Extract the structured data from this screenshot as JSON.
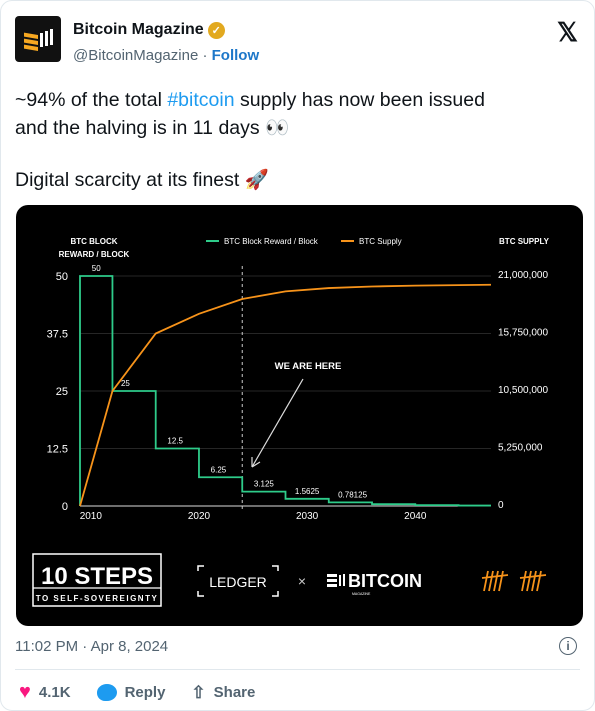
{
  "author": {
    "name": "Bitcoin Magazine",
    "handle": "@BitcoinMagazine",
    "separator": "·",
    "follow_label": "Follow",
    "verified_icon": "verified-badge-gold"
  },
  "platform_icon": "x-logo",
  "tweet": {
    "line1_pre": "~94% of the total ",
    "hashtag": "#bitcoin",
    "line1_post": " supply has now been issued",
    "line2": "and the halving is in 11 days 👀",
    "line3": "Digital scarcity at its finest 🚀"
  },
  "colors": {
    "hashtag": "#1d9bf0",
    "reward_line": "#2ecc8a",
    "supply_line": "#f7931a",
    "like": "#f91880"
  },
  "chart_data": {
    "type": "line",
    "left_axis_title": [
      "BTC BLOCK",
      "REWARD / BLOCK"
    ],
    "right_axis_title": "BTC SUPPLY",
    "legend": [
      "BTC Block Reward / Block",
      "BTC Supply"
    ],
    "legend_placement": "top-center",
    "xlim": [
      2009,
      2047
    ],
    "x_ticks": [
      "2010",
      "2020",
      "2030",
      "2040"
    ],
    "left_ylim": [
      0,
      50
    ],
    "left_ticks": [
      "0",
      "12.5",
      "25",
      "37.5",
      "50"
    ],
    "right_ylim": [
      0,
      21000000
    ],
    "right_ticks": [
      "0",
      "5,250,000",
      "10,500,000",
      "15,750,000",
      "21,000,000"
    ],
    "grid": true,
    "series": [
      {
        "name": "BTC Block Reward / Block",
        "kind": "step",
        "x": [
          2009,
          2012,
          2016,
          2020,
          2024,
          2028,
          2032,
          2036,
          2040,
          2044,
          2047
        ],
        "y": [
          50,
          25,
          12.5,
          6.25,
          3.125,
          1.5625,
          0.78125,
          0.390625,
          0.1953125,
          0.09765625,
          0.09765625
        ]
      },
      {
        "name": "BTC Supply",
        "x": [
          2009,
          2012,
          2016,
          2020,
          2024,
          2028,
          2032,
          2036,
          2040,
          2047
        ],
        "y": [
          0,
          10500000,
          15750000,
          17550000,
          18900000,
          19600000,
          19900000,
          20040000,
          20120000,
          20200000
        ]
      }
    ],
    "data_labels": [
      {
        "x": 2010.5,
        "y": 50,
        "text": "50"
      },
      {
        "x": 2013.2,
        "y": 25,
        "text": "25"
      },
      {
        "x": 2017.8,
        "y": 12.5,
        "text": "12.5"
      },
      {
        "x": 2021.8,
        "y": 6.25,
        "text": "6.25"
      },
      {
        "x": 2026,
        "y": 3.125,
        "text": "3.125"
      },
      {
        "x": 2030,
        "y": 1.5625,
        "text": "1.5625"
      },
      {
        "x": 2034.2,
        "y": 0.78125,
        "text": "0.78125"
      }
    ],
    "annotation": {
      "text": "WE ARE HERE",
      "x": 2024
    }
  },
  "branding": {
    "steps_title": "10 STEPS",
    "steps_sub": "TO SELF-SOVEREIGNTY",
    "ledger": "LEDGER",
    "times": "×",
    "bitcoin": "BITCOIN",
    "magazine": "MAGAZINE"
  },
  "footer": {
    "timestamp": "11:02 PM · Apr 8, 2024",
    "info_icon": "i"
  },
  "actions": {
    "likes": "4.1K",
    "reply": "Reply",
    "share": "Share"
  }
}
